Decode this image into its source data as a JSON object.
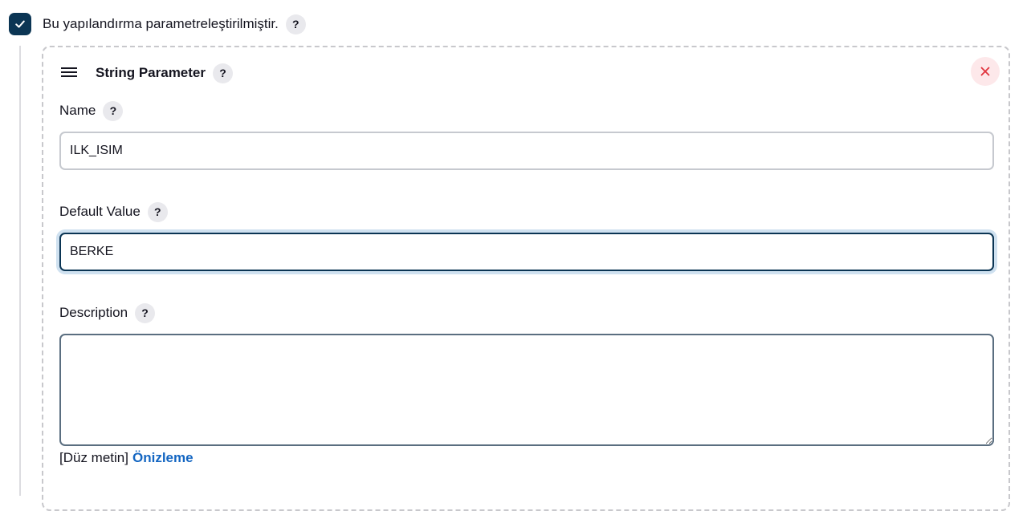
{
  "parameterized": {
    "checked": true,
    "label": "Bu yapılandırma parametreleştirilmiştir.",
    "help": "?"
  },
  "parameter": {
    "title": "String Parameter",
    "help": "?",
    "name": {
      "label": "Name",
      "help": "?",
      "value": "ILK_ISIM"
    },
    "default_value": {
      "label": "Default Value",
      "help": "?",
      "value": "BERKE"
    },
    "description": {
      "label": "Description",
      "help": "?",
      "value": ""
    },
    "format": {
      "current": "[Düz metin]",
      "preview_link": "Önizleme"
    }
  },
  "icons": {
    "checkbox": "check-icon",
    "drag": "hamburger-icon",
    "delete": "close-icon"
  },
  "colors": {
    "checkbox_bg": "#0b3554",
    "link": "#1466c2",
    "delete_bg": "#fde8ea",
    "delete_x": "#e0323c",
    "focus_ring": "#cfe1f0"
  }
}
